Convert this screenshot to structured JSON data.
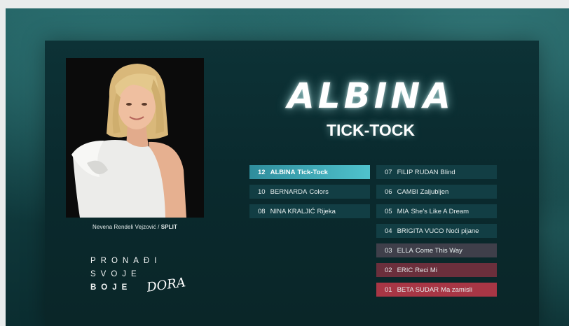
{
  "contestant": {
    "artist": "ALBINA",
    "song": "TICK-TOCK"
  },
  "photo": {
    "credit_prefix": "Nevena Rendeli Vejzović / ",
    "credit_city": "SPLIT"
  },
  "slogan": {
    "line1": "PRONAĐI",
    "line2": "SVOJE",
    "line3": "BOJE"
  },
  "brand": {
    "logo": "DORA"
  },
  "ranking": {
    "left": [
      {
        "rank": "12",
        "artist": "ALBINA",
        "song": "Tick-Tock"
      },
      {
        "rank": "10",
        "artist": "BERNARDA",
        "song": "Colors"
      },
      {
        "rank": "08",
        "artist": "NINA KRALJIĆ",
        "song": "Rijeka"
      }
    ],
    "right": [
      {
        "rank": "07",
        "artist": "FILIP RUDAN",
        "song": "Blind"
      },
      {
        "rank": "06",
        "artist": "CAMBI",
        "song": "Zaljubljen"
      },
      {
        "rank": "05",
        "artist": "MIA",
        "song": "She's Like A Dream"
      },
      {
        "rank": "04",
        "artist": "BRIGITA VUCO",
        "song": "Noći pijane"
      },
      {
        "rank": "03",
        "artist": "ELLA",
        "song": "Come This Way"
      },
      {
        "rank": "02",
        "artist": "ERIC",
        "song": "Reci Mi"
      },
      {
        "rank": "01",
        "artist": "BETA SUDAR",
        "song": "Ma zamisli"
      }
    ]
  },
  "colors": {
    "highlight_row": "#4fc2cd",
    "default_row": "#123e44",
    "rank_3": "#3f3f4a",
    "rank_2": "#6b2f3c",
    "rank_1": "#a83645"
  }
}
